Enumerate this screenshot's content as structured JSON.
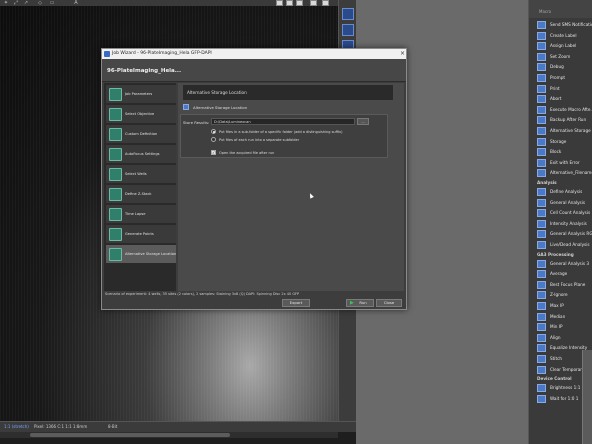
{
  "window": {
    "title": "Job Wizard - 96-PlateImaging_Hela GFP-DAPI"
  },
  "dialog": {
    "header": "96-PlateImaging_Hela...",
    "close_glyph": "×",
    "steps": [
      {
        "label": "Job Parameters",
        "icon": "parameters-icon"
      },
      {
        "label": "Select Objective",
        "icon": "objective-icon"
      },
      {
        "label": "Custom Definition",
        "icon": "definition-icon"
      },
      {
        "label": "AutoFocus Settings",
        "icon": "autofocus-icon"
      },
      {
        "label": "Select Wells",
        "icon": "wells-icon"
      },
      {
        "label": "Define Z-Stack",
        "icon": "zstack-icon"
      },
      {
        "label": "Time Lapse",
        "icon": "timelapse-icon"
      },
      {
        "label": "Generate Points",
        "icon": "points-icon"
      },
      {
        "label": "Alternative Storage Location",
        "icon": "storage-icon"
      }
    ],
    "active_step": 8,
    "content": {
      "heading": "Alternative Storage Location",
      "subheading": "Alternative Storage Location",
      "store_label": "Store Results:",
      "store_value": "D:\\Data\\Luminexcan",
      "browse_label": "...",
      "radio_1": "Put files in a sub-folder of a specific folder (add a distinguishing suffix)",
      "radio_2": "Put files of each run into a separate subfolder",
      "radio_selected": 1,
      "checkbox_label": "Open the acquired file after run",
      "checkbox_checked": true
    },
    "summary": "Scenario of experiment: 4 wells, 35 sites (2 colors), 2 samples: Staining 3x8 (Q) DAPI: Spinning Disc 2x 40 GFP",
    "buttons": {
      "export": "Export",
      "run": "Run",
      "close": "Close"
    }
  },
  "status_bar": {
    "zoom": "1:1 (stretch)",
    "pixel": "Pixel: 1366  C:1  1:1  1:8mm",
    "value": "8-Bit"
  },
  "right_panel": {
    "tab": "Macro",
    "items": [
      "Send SMS Notification",
      "Create Label",
      "Assign Label",
      "Set Zoom",
      "Debug",
      "Prompt",
      "Print",
      "Abort",
      "Execute Macro Afte...",
      "Backup After Run",
      "Alternative Storage",
      "Storage",
      "Block",
      "Exit with Error",
      "Alternative_Filename"
    ],
    "section_analysis": "Analysis",
    "analysis_items": [
      "Define Analysis",
      "General Analysis",
      "Cell Count Analysis",
      "Intensity Analysis",
      "General Analysis RGB",
      "Live/Dead Analysis"
    ],
    "section_ga3": "GA3 Processing",
    "ga3_items": [
      "General Analysis 3",
      "Average",
      "Best Focus Plane",
      "Z-Ignore",
      "Max IP",
      "Median",
      "Min IP",
      "Align",
      "Equalize Intensity",
      "Stitch",
      "Clear Temporary"
    ],
    "section_device": "Device Control",
    "device_items": [
      "Brightness 1:1 L",
      "Wait for 1:0 1"
    ]
  },
  "colors": {
    "accent": "#4a79c8",
    "run_icon": "#39c45a",
    "dialog_bg": "#3d3d3d"
  }
}
